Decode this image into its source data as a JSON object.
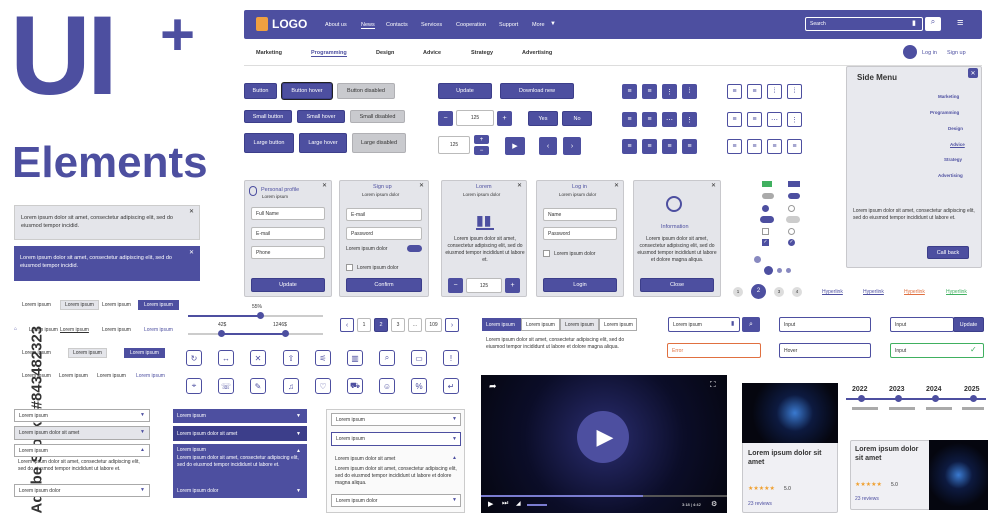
{
  "hero": {
    "line1": "UI",
    "plus": "+",
    "line2": "Elements"
  },
  "watermark": {
    "text": "Adobe Stock | #843482323"
  },
  "navbar": {
    "logo": "LOGO",
    "links": [
      "About us",
      "News",
      "Contacts",
      "Services",
      "Cooperation",
      "Support",
      "More"
    ],
    "search_placeholder": "Search"
  },
  "subnav": {
    "items": [
      "Marketing",
      "Programming",
      "Design",
      "Advice",
      "Strategy",
      "Advertising"
    ],
    "login": "Log in",
    "signup": "Sign up"
  },
  "buttons": {
    "button": "Button",
    "hover": "Button hover",
    "disabled": "Button disabled",
    "small": "Small button",
    "small_hover": "Small hover",
    "small_disabled": "Small disabled",
    "large": "Large button",
    "large_hover": "Large hover",
    "large_disabled": "Large disabled",
    "update": "Update",
    "download": "Download new",
    "yes": "Yes",
    "no": "No"
  },
  "steppers": {
    "v1": "125",
    "v2": "125",
    "v3": "125"
  },
  "side_menu": {
    "title": "Side Menu",
    "items": [
      "Marketing",
      "Programming",
      "Design",
      "Advice",
      "Strategy",
      "Advertising"
    ],
    "text": "Lorem ipsum dolor sit amet, consectetur adipiscing elit, sed do eiusmod tempor incididunt ut labore et.",
    "call": "Call back"
  },
  "alerts": {
    "a1": "Lorem ipsum dolor sit amet, consectetur adipiscing elit, sed do eiusmod tempor incidid.",
    "a2": "Lorem ipsum dolor sit amet, consectetur adipiscing elit, sed do eiusmod tempor incidid."
  },
  "profile": {
    "title": "Personal profile",
    "sub": "Lorem ipsum",
    "fields": [
      "Full Name",
      "E-mail",
      "Phone"
    ],
    "btn": "Update"
  },
  "signup": {
    "title": "Sign up",
    "sub": "Lorem ipsum dolor",
    "fields": [
      "E-mail",
      "Password"
    ],
    "toggle": "Lorem ipsum dolor",
    "check": "Lorem ipsum dolor",
    "btn": "Confirm"
  },
  "lorem_card": {
    "title": "Lorem",
    "sub": "Lorem ipsum dolor",
    "text": "Lorem ipsum dolor sit amet, consectetur adipiscing elit, sed do eiusmod tempor incididunt ut labore et.",
    "value": "125"
  },
  "login": {
    "title": "Log in",
    "sub": "Lorem ipsum dolor",
    "fields": [
      "Name",
      "Password"
    ],
    "check": "Lorem ipsum dolor",
    "btn": "Login"
  },
  "info": {
    "title": "Information",
    "text": "Lorem ipsum dolor sit amet, consectetur adipiscing elit, sed do eiusmod tempor incididunt ut labore et dolore magna aliqua.",
    "btn": "Close"
  },
  "breadcrumbs": {
    "items": [
      "Lorem ipsum",
      "Lorem ipsum",
      "Lorem ipsum",
      "Lorem ipsum"
    ]
  },
  "slider": {
    "pct": "55%",
    "min": "42$",
    "max": "1246$"
  },
  "pagination": {
    "pages": [
      "1",
      "2",
      "3",
      "...",
      "109"
    ]
  },
  "tabs": {
    "items": [
      "Lorem ipsum",
      "Lorem ipsum",
      "Lorem ipsum",
      "Lorem ipsum"
    ],
    "text": "Lorem ipsum dolor sit amet, consectetur adipiscing elit, sed do eiusmod tempor incididunt ut labore et dolore magna aliqua."
  },
  "search2": {
    "value": "Lorem ipsum"
  },
  "inputs": {
    "input": "Input",
    "error": "Error",
    "hover": "Hover",
    "input2": "Input",
    "update": "Update",
    "input3": "Input"
  },
  "links": {
    "h1": "Hyperlink",
    "h2": "Hyperlink",
    "h3": "Hyperlink",
    "h4": "Hyperlink",
    "pages": [
      "1",
      "2",
      "3",
      "4"
    ]
  },
  "dropdowns": {
    "item": "Lorem ipsum",
    "item2": "Lorem ipsum dolor sit amet",
    "text": "Lorem ipsum dolor sit amet, consectetur adipiscing elit, sed do eiusmod tempor incididunt ut labore et.",
    "text2": "Lorem ipsum dolor sit amet, consectetur adipiscing elit, sed do eiusmod tempor incididunt ut labore et dolore magna aliqua.",
    "last": "Lorem ipsum dolor"
  },
  "video": {
    "time": "3:18 | 4:42"
  },
  "timeline": {
    "years": [
      "2022",
      "2023",
      "2024",
      "2025"
    ]
  },
  "product": {
    "title": "Lorem ipsum dolor sit amet",
    "rating": "5.0",
    "reviews": "23 reviews"
  },
  "colors": {
    "accent": "#4d4fa0",
    "error": "#e07040",
    "success": "#40b060"
  }
}
